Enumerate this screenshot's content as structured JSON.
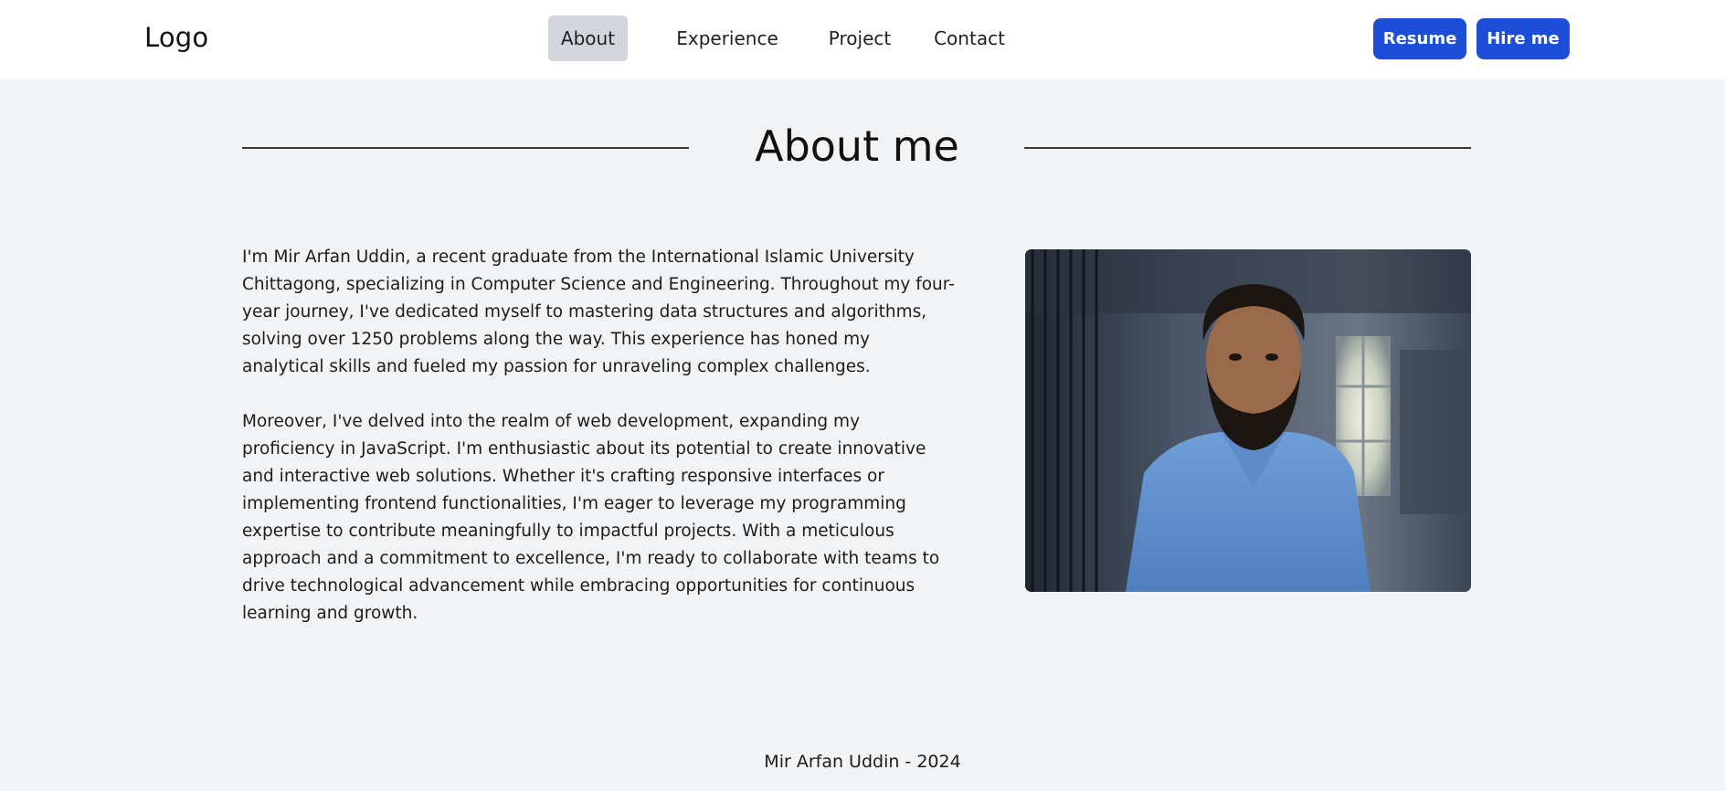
{
  "nav": {
    "logo": "Logo",
    "links": [
      {
        "label": "About",
        "active": true
      },
      {
        "label": "Experience",
        "active": false
      },
      {
        "label": "Project",
        "active": false
      },
      {
        "label": "Contact",
        "active": false
      }
    ],
    "resume_label": "Resume",
    "hire_label": "Hire me"
  },
  "about": {
    "title": "About me",
    "paragraphs": [
      "I'm Mir Arfan Uddin, a recent graduate from the International Islamic University Chittagong, specializing in Computer Science and Engineering. Throughout my four-year journey, I've dedicated myself to mastering data structures and algorithms, solving over 1250 problems along the way. This experience has honed my analytical skills and fueled my passion for unraveling complex challenges.",
      "Moreover, I've delved into the realm of web development, expanding my proficiency in JavaScript. I'm enthusiastic about its potential to create innovative and interactive web solutions. Whether it's crafting responsive interfaces or implementing frontend functionalities, I'm eager to leverage my programming expertise to contribute meaningfully to impactful projects. With a meticulous approach and a commitment to excellence, I'm ready to collaborate with teams to drive technological advancement while embracing opportunities for continuous learning and growth."
    ]
  },
  "footer": {
    "text": "Mir Arfan Uddin - 2024"
  },
  "colors": {
    "accent": "#1d4ed8",
    "page_background": "#f2f3f5",
    "nav_active_background": "#d2d6dc"
  }
}
